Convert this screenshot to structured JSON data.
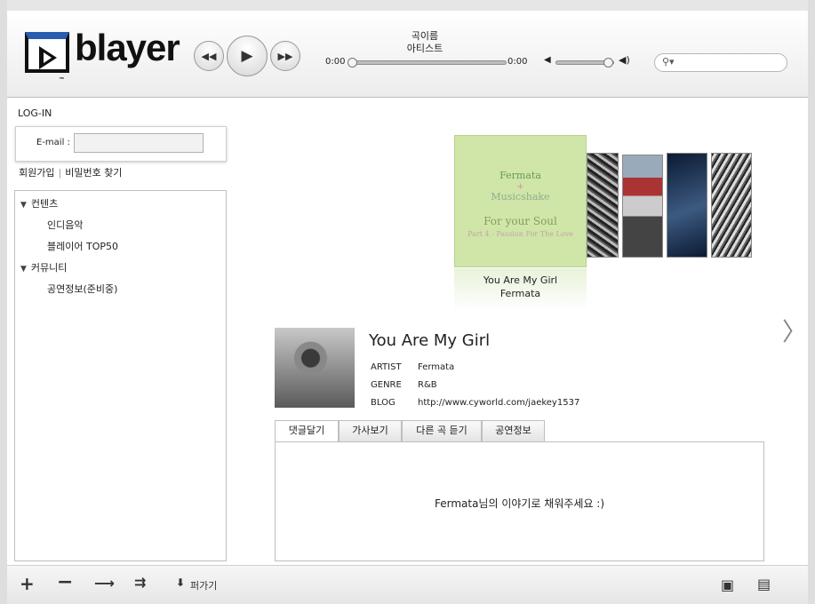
{
  "header": {
    "logo_text": "blayer",
    "logo_tm": "™",
    "track_title": "곡이름",
    "track_artist": "아티스트",
    "time_current": "0:00",
    "time_total": "0:00",
    "search_placeholder": ""
  },
  "icons": {
    "prev": "prev-icon",
    "play": "play-icon",
    "next": "next-icon",
    "volume_low": "volume-low-icon",
    "volume_high": "volume-high-icon",
    "search": "search-icon",
    "add": "plus-icon",
    "remove": "minus-icon",
    "move": "arrow-right-icon",
    "shuffle": "shuffle-icon",
    "scrap": "download-icon",
    "save": "floppy-icon",
    "delete": "trash-icon",
    "next_cover": "chevron-right-icon"
  },
  "login": {
    "title": "LOG-IN",
    "email_label": "E-mail :",
    "email_value": "",
    "signup": "회원가입",
    "separator": "|",
    "find_password": "비밀번호 찾기"
  },
  "tree": {
    "sections": [
      {
        "label": "컨텐츠",
        "items": [
          "인디음악",
          "블레이어 TOP50"
        ]
      },
      {
        "label": "커뮤니티",
        "items": [
          "공연정보(준비중)"
        ]
      }
    ]
  },
  "coverflow": {
    "main_cover": {
      "line1": "Fermata",
      "line2": "+",
      "line3": "Musicshake",
      "line4": "For your Soul",
      "line5": "Part 4 - Passion For The Love"
    },
    "caption_title": "You Are My Girl",
    "caption_artist": "Fermata"
  },
  "detail": {
    "title": "You Are My Girl",
    "artist_label": "ARTIST",
    "artist": "Fermata",
    "genre_label": "GENRE",
    "genre": "R&B",
    "blog_label": "BLOG",
    "blog": "http://www.cyworld.com/jaekey1537"
  },
  "tabs": [
    {
      "label": "댓글달기",
      "active": true
    },
    {
      "label": "가사보기",
      "active": false
    },
    {
      "label": "다른 곡 듣기",
      "active": false
    },
    {
      "label": "공연정보",
      "active": false
    }
  ],
  "comment": {
    "message": "Fermata님의 이야기로 채워주세요 :)"
  },
  "toolbar": {
    "scrap_label": "퍼가기"
  },
  "player": {
    "seek_fraction": 0.0,
    "volume_fraction": 0.95
  }
}
